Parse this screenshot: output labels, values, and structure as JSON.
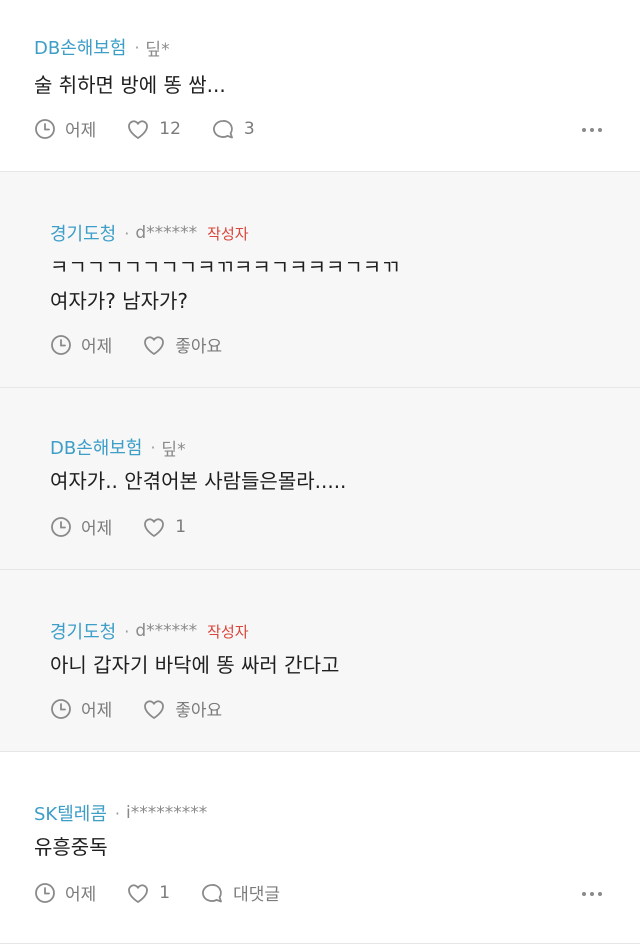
{
  "comments": [
    {
      "company": "DB손해보험",
      "user": "딮*",
      "badge": "",
      "lines": [
        "술 취하면 방에 똥 쌈..."
      ],
      "time": "어제",
      "likes": "12",
      "replies": "3"
    },
    {
      "company": "경기도청",
      "user": "d******",
      "badge": "작성자",
      "lines": [
        "ㅋㄱㄱㄱㄱㄱㄱㄱㅋㄲㅋㅋㄱㅋㅋㅋㄱㅋㄲ",
        "여자가? 남자가?"
      ],
      "time": "어제",
      "likes": "좋아요"
    },
    {
      "company": "DB손해보험",
      "user": "딮*",
      "badge": "",
      "lines": [
        "여자가.. 안겪어본 사람들은몰라....."
      ],
      "time": "어제",
      "likes": "1"
    },
    {
      "company": "경기도청",
      "user": "d******",
      "badge": "작성자",
      "lines": [
        "아니 갑자기 바닥에 똥 싸러 간다고"
      ],
      "time": "어제",
      "likes": "좋아요"
    },
    {
      "company": "SK텔레콤",
      "user": "i*********",
      "badge": "",
      "lines": [
        "유흥중독"
      ],
      "time": "어제",
      "likes": "1",
      "replies": "대댓글"
    }
  ],
  "icons": {
    "time": "clock-icon",
    "like": "heart-icon",
    "reply": "comment-bubble-icon",
    "more": "more-options-icon"
  },
  "colors": {
    "company": "#3d9ec7",
    "badge": "#d9453a",
    "reply_background": "#f7f7f8"
  }
}
